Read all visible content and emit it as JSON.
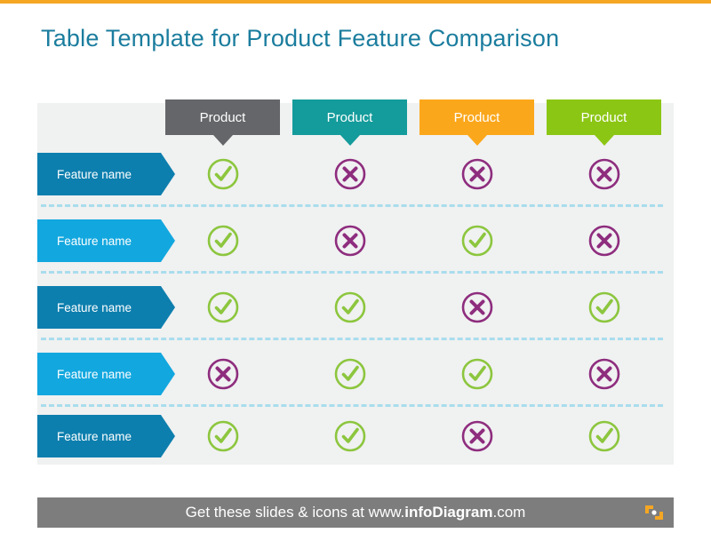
{
  "slide": {
    "title": "Table Template for Product Feature Comparison",
    "title_color": "#1B7D9E",
    "accent_bar_color": "#F5A623",
    "panel_bg": "#F0F1F1",
    "divider_color": "#A9DDED"
  },
  "columns": [
    {
      "label": "Product",
      "color": "#646669"
    },
    {
      "label": "Product",
      "color": "#149B9B"
    },
    {
      "label": "Product",
      "color": "#FBA71B"
    },
    {
      "label": "Product",
      "color": "#8CC614"
    }
  ],
  "rows": [
    {
      "label": "Feature name",
      "color": "#0D7FAE",
      "values": [
        "check",
        "cross",
        "cross",
        "cross"
      ]
    },
    {
      "label": "Feature name",
      "color": "#12A7DF",
      "values": [
        "check",
        "cross",
        "check",
        "cross"
      ]
    },
    {
      "label": "Feature name",
      "color": "#0D7FAE",
      "values": [
        "check",
        "check",
        "cross",
        "check"
      ]
    },
    {
      "label": "Feature name",
      "color": "#12A7DF",
      "values": [
        "cross",
        "check",
        "check",
        "cross"
      ]
    },
    {
      "label": "Feature name",
      "color": "#0D7FAE",
      "values": [
        "check",
        "check",
        "cross",
        "check"
      ]
    }
  ],
  "icon_colors": {
    "check": "#8CC63E",
    "cross": "#8E2D7E"
  },
  "footer": {
    "text_before": "Get these slides & icons at www.",
    "text_brand": "infoDiagram",
    "text_after": ".com",
    "bg": "#7D7D7D",
    "logo_color": "#F5A623"
  }
}
